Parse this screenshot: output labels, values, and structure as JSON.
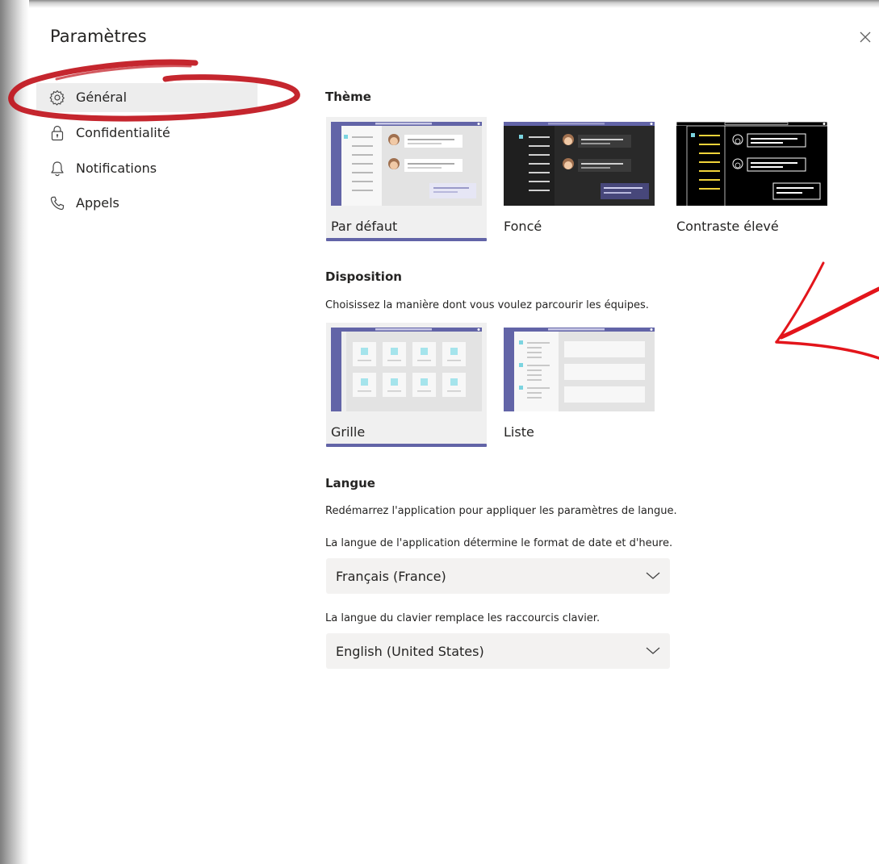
{
  "dialog": {
    "title": "Paramètres",
    "close_icon": "close-icon"
  },
  "sidebar": {
    "items": [
      {
        "label": "Général",
        "icon": "gear-icon",
        "active": true
      },
      {
        "label": "Confidentialité",
        "icon": "lock-icon",
        "active": false
      },
      {
        "label": "Notifications",
        "icon": "bell-icon",
        "active": false
      },
      {
        "label": "Appels",
        "icon": "phone-icon",
        "active": false
      }
    ]
  },
  "theme": {
    "heading": "Thème",
    "options": [
      {
        "label": "Par défaut",
        "selected": true
      },
      {
        "label": "Foncé",
        "selected": false
      },
      {
        "label": "Contraste élevé",
        "selected": false
      }
    ]
  },
  "layout": {
    "heading": "Disposition",
    "description": "Choisissez la manière dont vous voulez parcourir les équipes.",
    "options": [
      {
        "label": "Grille",
        "selected": true
      },
      {
        "label": "Liste",
        "selected": false
      }
    ]
  },
  "language": {
    "heading": "Langue",
    "restart_note": "Redémarrez l'application pour appliquer les paramètres de langue.",
    "app_lang_note": "La langue de l'application détermine le format de date et d'heure.",
    "app_lang_value": "Français (France)",
    "keyboard_note": "La langue du clavier remplace les raccourcis clavier.",
    "keyboard_value": "English (United States)"
  },
  "colors": {
    "accent": "#6264a7",
    "annotation": "#c0141c"
  }
}
